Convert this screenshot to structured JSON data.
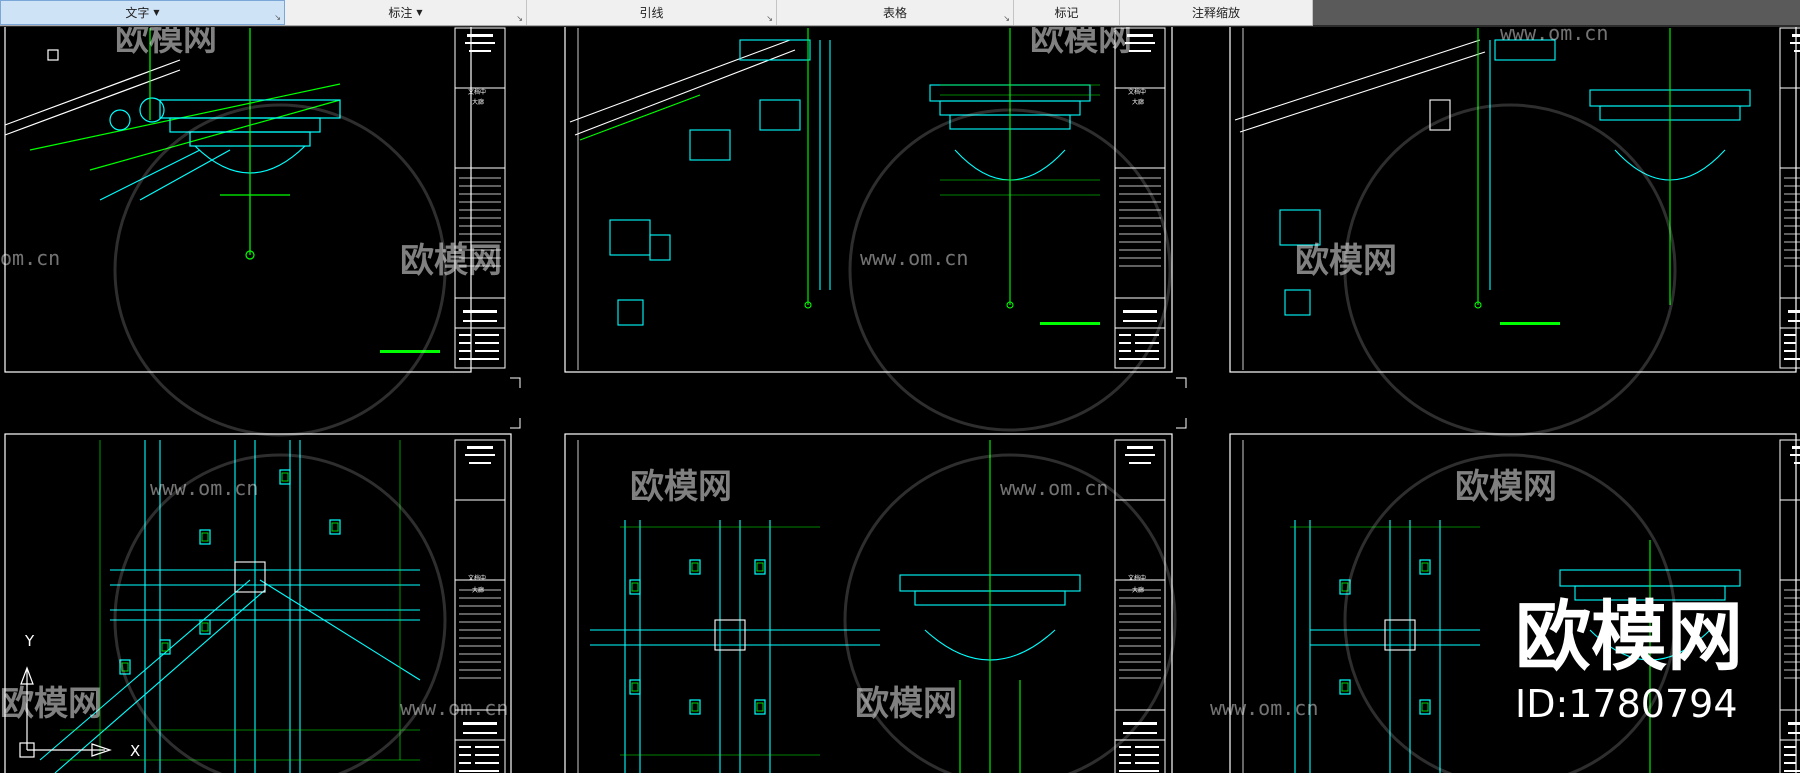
{
  "ribbon": {
    "panels": [
      {
        "label": "文字",
        "has_dropdown": true,
        "active": true
      },
      {
        "label": "标注",
        "has_dropdown": true,
        "active": false
      },
      {
        "label": "引线",
        "has_dropdown": false,
        "active": false
      },
      {
        "label": "表格",
        "has_dropdown": false,
        "active": false
      },
      {
        "label": "标记",
        "has_dropdown": false,
        "active": false
      },
      {
        "label": "注释缩放",
        "has_dropdown": false,
        "active": false
      }
    ]
  },
  "watermark": {
    "brand": "欧模网",
    "url": "www.om.cn",
    "url_fragment": "om.cn",
    "id_label": "ID:1780794"
  },
  "drawing": {
    "title_block_lines": [
      "文档中",
      "大廊"
    ],
    "ucs_x_label": "X",
    "ucs_y_label": "Y"
  },
  "colors": {
    "cad_background": "#000000",
    "line_green": "#00ff00",
    "line_cyan": "#00ffff",
    "line_white": "#ffffff",
    "ribbon_bg": "#f0f0f0",
    "ribbon_active": "#cfe3f7"
  }
}
